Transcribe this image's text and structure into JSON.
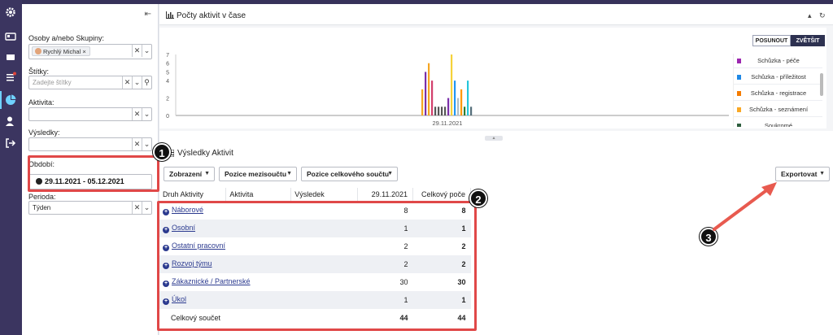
{
  "sidebar_icons": [
    "gear-icon",
    "id-card-icon",
    "calendar-icon",
    "tasks-icon",
    "chart-icon",
    "user-settings-icon",
    "logout-icon"
  ],
  "filter": {
    "persons_label": "Osoby a/nebo Skupiny:",
    "persons_chip": "Rychlý Michal",
    "tags_label": "Štítky:",
    "tags_placeholder": "Zadejte štítky",
    "activity_label": "Aktivita:",
    "results_label": "Výsledky:",
    "period_label": "Období:",
    "period_value": "29.11.2021 - 05.12.2021",
    "periodicity_label": "Perioda:",
    "periodicity_value": "Týden"
  },
  "chart_panel": {
    "title": "Počty aktivit v čase",
    "toggle_shift": "POSUNOUT",
    "toggle_zoom": "ZVĚTŠIT"
  },
  "chart_data": {
    "type": "bar",
    "categories": [
      "29.11.2021"
    ],
    "ylim": [
      0,
      7
    ],
    "yticks": [
      "0",
      "2",
      "4",
      "5",
      "6",
      "7"
    ],
    "bars": [
      3,
      5,
      6,
      4,
      1,
      1,
      1,
      1,
      2,
      7,
      4,
      2,
      3,
      1,
      4,
      1
    ],
    "bar_colors": [
      "#f5a623",
      "#7b2fa8",
      "#f5a623",
      "#d23f6b",
      "#555555",
      "#555555",
      "#555555",
      "#555555",
      "#7b2fa8",
      "#f5d23a",
      "#2196f3",
      "#b0bec5",
      "#ff9800",
      "#2e7d32",
      "#26c6da",
      "#546e7a"
    ],
    "legend": [
      {
        "name": "Schůzka - péče",
        "color": "#9c27b0"
      },
      {
        "name": "Schůzka - příležitost",
        "color": "#1e88e5"
      },
      {
        "name": "Schůzka - registrace",
        "color": "#f57c00"
      },
      {
        "name": "Schůzka - seznámení",
        "color": "#f9a825"
      },
      {
        "name": "Soukromé",
        "color": "#2e5e3e"
      }
    ]
  },
  "results": {
    "title": "Výsledky Aktivit",
    "buttons": {
      "display": "Zobrazení",
      "subtotal": "Pozice mezisoučtu",
      "total": "Pozice celkového součtu",
      "export": "Exportovat"
    },
    "columns": [
      "Druh Aktivity",
      "Aktivita",
      "Výsledek",
      "29.11.2021",
      "Celkový poče"
    ],
    "rows": [
      {
        "name": "Náborové",
        "date": "8",
        "total": "8"
      },
      {
        "name": "Osobní",
        "date": "1",
        "total": "1"
      },
      {
        "name": "Ostatní pracovní",
        "date": "2",
        "total": "2"
      },
      {
        "name": "Rozvoj týmu",
        "date": "2",
        "total": "2"
      },
      {
        "name": "Zákaznické / Partnerské",
        "date": "30",
        "total": "30"
      },
      {
        "name": "Úkol",
        "date": "1",
        "total": "1"
      }
    ],
    "grand_total_label": "Celkový součet",
    "grand_total_date": "44",
    "grand_total": "44"
  },
  "markers": [
    "1",
    "2",
    "3"
  ]
}
